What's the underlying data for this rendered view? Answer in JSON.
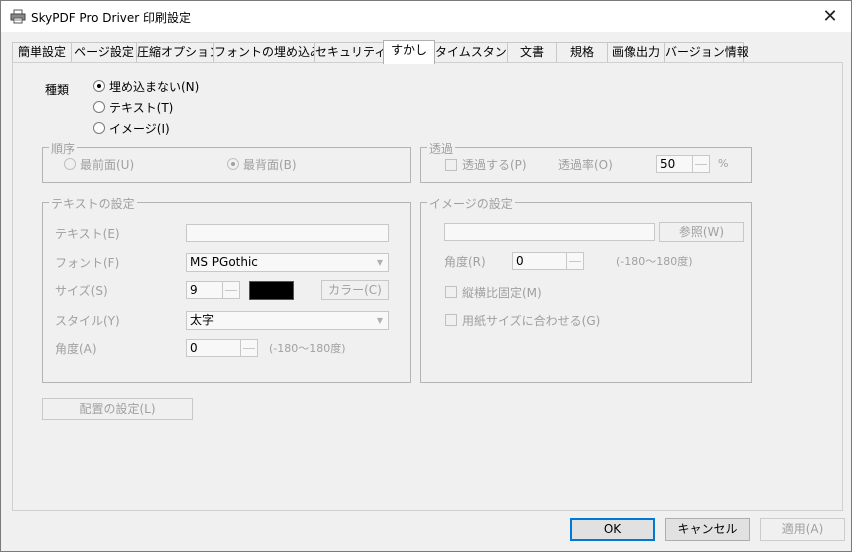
{
  "window": {
    "title": "SkyPDF Pro Driver 印刷設定",
    "close_glyph": "✕"
  },
  "tabs": [
    {
      "label": "簡単設定",
      "active": false
    },
    {
      "label": "ページ設定",
      "active": false
    },
    {
      "label": "圧縮オプション",
      "active": false
    },
    {
      "label": "フォントの埋め込み",
      "active": false
    },
    {
      "label": "セキュリティー",
      "active": false
    },
    {
      "label": "すかし",
      "active": true
    },
    {
      "label": "タイムスタンプ",
      "active": false
    },
    {
      "label": "文書",
      "active": false
    },
    {
      "label": "規格",
      "active": false
    },
    {
      "label": "画像出力",
      "active": false
    },
    {
      "label": "バージョン情報",
      "active": false
    }
  ],
  "kind": {
    "label": "種類",
    "options": [
      {
        "label": "埋め込まない(N)",
        "checked": true
      },
      {
        "label": "テキスト(T)",
        "checked": false
      },
      {
        "label": "イメージ(I)",
        "checked": false
      }
    ]
  },
  "order": {
    "label": "順序",
    "front": "最前面(U)",
    "back": "最背面(B)",
    "selected": "back"
  },
  "transparency": {
    "label": "透過",
    "check_label": "透過する(P)",
    "rate_label": "透過率(O)",
    "rate_value": "50",
    "unit": "%"
  },
  "text_settings": {
    "label": "テキストの設定",
    "text_label": "テキスト(E)",
    "text_value": "",
    "font_label": "フォント(F)",
    "font_value": "MS PGothic",
    "size_label": "サイズ(S)",
    "size_value": "9",
    "color_button": "カラー(C)",
    "color_value": "#000000",
    "style_label": "スタイル(Y)",
    "style_value": "太字",
    "angle_label": "角度(A)",
    "angle_value": "0",
    "angle_range": "(-180～180度)"
  },
  "image_settings": {
    "label": "イメージの設定",
    "path_value": "",
    "browse_button": "参照(W)",
    "angle_label": "角度(R)",
    "angle_value": "0",
    "angle_range": "(-180～180度)",
    "keep_ratio": "縦横比固定(M)",
    "fit_paper": "用紙サイズに合わせる(G)"
  },
  "layout_button": "配置の設定(L)",
  "footer": {
    "ok": "OK",
    "cancel": "キャンセル",
    "apply": "適用(A)"
  }
}
